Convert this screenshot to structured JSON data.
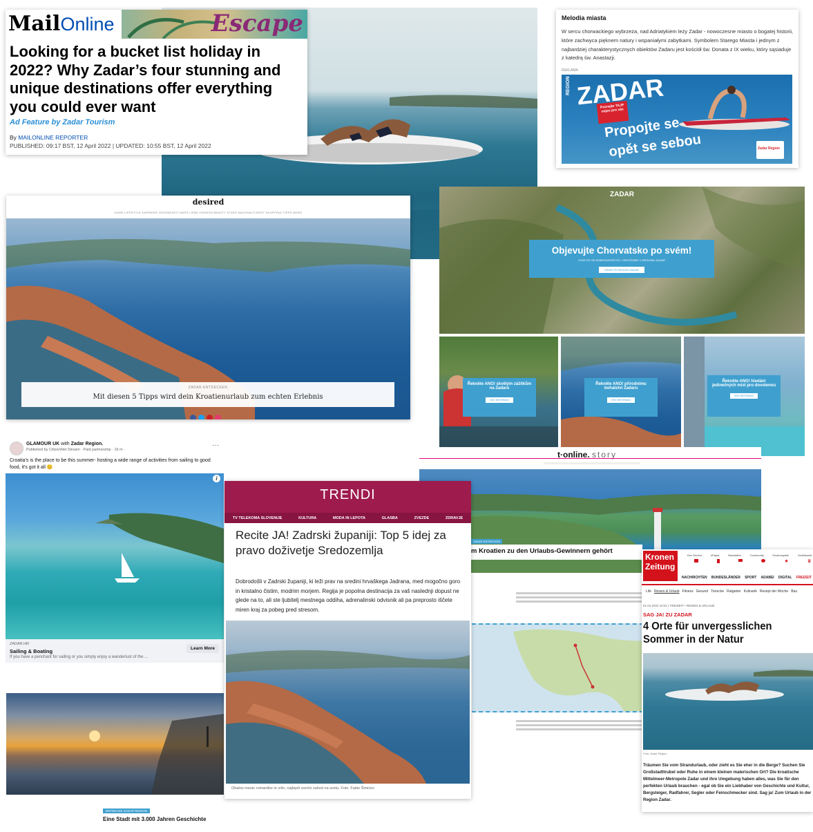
{
  "mail": {
    "brand_bold": "Mail",
    "brand_light": "Online",
    "escape": "Escape",
    "headline": "Looking for a bucket list holiday in 2022? Why Zadar’s four stunning and unique destinations offer everything you could ever want",
    "ad_feature": "Ad Feature by Zadar Tourism",
    "by": "By ",
    "reporter": "MAILONLINE REPORTER",
    "published": "PUBLISHED: 09:17 BST, 12 April 2022 | UPDATED: 10:55 BST, 12 April 2022"
  },
  "melodia": {
    "title": "Melodia miasta",
    "body": "W sercu chorwackiego wybrzeża, nad Adriatykiem leży Zadar - nowoczesne miasto o bogatej historii, które zachwyca pięknem natury i wspaniałymi zabytkami. Symbolem Starego Miasta i jednym z najbardziej charakterystycznych obiektów Zadaru jest kościół św. Donata z IX wieku, który sąsiaduje z katedrą św. Anastazji.",
    "reklama": "REKLAMA",
    "ad_region": "REGION",
    "ad_zadar": "ZADAR",
    "ad_sticker": "Poznejte TAJP nejen pro vás",
    "ad_line1": "Propojte se",
    "ad_line2": "opět se sebou",
    "ad_logo": "Zadar Region"
  },
  "desired": {
    "logo": "desired",
    "nav": "HOME   LIFESTYLE  KARRIERE  GESUNDHEIT  MAPS  LIEBE  FASHION  BEAUTY  STARS  NACHHALTIGKEIT  SHOPPING-TIPPS  NEWS",
    "kicker": "ZADAR ENTDECKEN",
    "caption": "Mit diesen 5 Tipps wird dein Kroatienurlaub zum echten Erlebnis"
  },
  "chorv": {
    "logo": "ZADAR",
    "headline": "Objevujte Chorvatsko po svém!",
    "sub": "VYDEJTE SE DOBRODRUŽSTVÍ • ODPOČINEK V REGIONU ZADAR",
    "btn": "OBJEVTE REGION ZADAR",
    "cards": [
      {
        "title": "Řekněte ANO! skvělým zážitkům na Zadaru",
        "btn": "VÍCE INFORMACÍ"
      },
      {
        "title": "Řekněte ANO! přírodnímu bohatství Zadaru",
        "btn": "VÍCE INFORMACÍ"
      },
      {
        "title": "Řekněte ANO! hledání jedinečných míst pro dovolenou",
        "btn": "VÍCE INFORMACÍ"
      }
    ]
  },
  "glamour": {
    "page": "GLAMOUR UK",
    "with": " with ",
    "partner": "Zadar Region.",
    "meta": "Published by CitizenNet Stream · Paid partnership · 16 m · ",
    "text": "Croatia's  is the place to be this summer- hosting a wide range of activities from sailing to good food, it's got it all 😊",
    "site": "ZADAR.HR",
    "title": "Sailing & Boating",
    "desc": "If you have a penchant for sailing or you simply enjoy a wanderlust of the ...",
    "cta": "Learn More"
  },
  "trendi": {
    "brand": "TRENDI",
    "nav": [
      "TV TELEKOMA SLOVENIJE",
      "KULTURA",
      "MODA IN LEPOTA",
      "GLASBA",
      "ZVEZDE",
      "ZDRAVJE"
    ],
    "headline": "Recite JA! Zadrski županiji: Top 5 idej za pravo doživetje Sredozemlja",
    "body": "Dobrodošli v Zadrski županiji, ki leži prav na sredini hrvaškega Jadrana, med mogočno goro in kristalno čistim, modrim morjem. Regija je popolna destinacija za vaš naslednji dopust ne glede na to, ali ste ljubitelj mestnega oddiha, adrenalinski odvisnik ali pa preprosto iščete miren kraj za pobeg pred stresom.",
    "caption": "Obalno mesto romantike in vrlin, najlepši sončni zahod na svetu. Foto: Fabio Šimićev"
  },
  "tonline": {
    "brand": "t·online.",
    "brand2": "story",
    "headline": "m Kroatien zu den Urlaubs-Gewinnern gehört",
    "tag": "ZADAR ENTDECKEN"
  },
  "sunset": {
    "badge": "ENTDECKE ZADAR REGION",
    "caption": "Eine Stadt mit 3.000 Jahren Geschichte"
  },
  "krone": {
    "logo1": "Kronen",
    "logo2": "Zeitung",
    "top_links": [
      "Kim Service",
      "ePaper",
      "Newsletter",
      "Community",
      "Gewinnspiele",
      "Vorteilswelt"
    ],
    "nav": [
      "NACHRICHTEN",
      "BUNDESLÄNDER",
      "SPORT",
      "ADABEI",
      "DIGITAL",
      "FREIZEIT"
    ],
    "subnav": [
      "Life",
      "Reisen & Urlaub",
      "Fitness",
      "Gesund",
      "Tierecke",
      "Ratgeber",
      "Kulinarik",
      "Rezept der Woche",
      "Bau"
    ],
    "date": "01.04.2022 10:01 | FREIZEIT • REISEN & URLAUB",
    "kicker": "SAG JA! ZU ZADAR",
    "headline": "4 Orte für unvergesslichen Sommer in der Natur",
    "credit": "Foto: Zadar Region",
    "body": "Träumen Sie vom Strandurlaub, oder zieht es Sie eher in die Berge? Suchen Sie Großstadttrubel oder Ruhe in einem kleinen malerischen Ort? Die kroatische Mittelmeer-Metropole Zadar und ihre Umgebung haben alles, was Sie für den perfekten Urlaub brauchen - egal ob Sie ein Liebhaber von Geschichte und Kultur, Bergsteiger, Radfahrer, Segler oder Feinschmecker sind. Sag ja! Zum Urlaub in der Region Zadar."
  }
}
